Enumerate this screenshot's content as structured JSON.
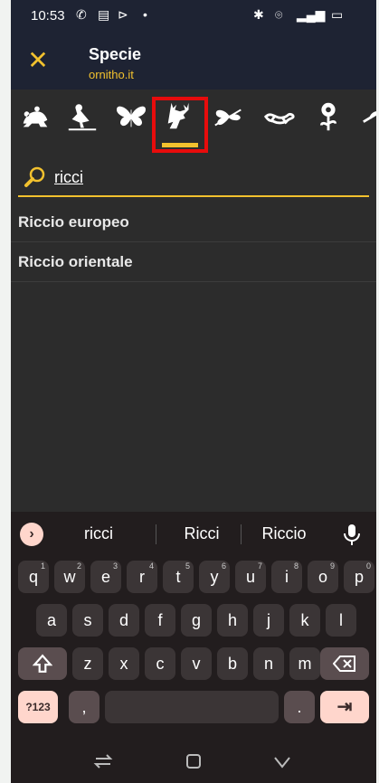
{
  "status": {
    "time": "10:53"
  },
  "appbar": {
    "title": "Specie",
    "subtitle": "ornitho.it"
  },
  "categories": [
    {
      "name": "amphibians",
      "selected": false
    },
    {
      "name": "birds",
      "selected": false
    },
    {
      "name": "butterflies",
      "selected": false
    },
    {
      "name": "mammals",
      "selected": true
    },
    {
      "name": "dragonflies",
      "selected": false
    },
    {
      "name": "reptiles",
      "selected": false
    },
    {
      "name": "plants",
      "selected": false
    },
    {
      "name": "more",
      "selected": false
    }
  ],
  "search": {
    "value": "ricci"
  },
  "results": [
    "Riccio europeo",
    "Riccio orientale"
  ],
  "keyboard": {
    "suggestions": [
      "ricci",
      "Ricci",
      "Riccio"
    ],
    "row1": [
      {
        "k": "q",
        "n": "1"
      },
      {
        "k": "w",
        "n": "2"
      },
      {
        "k": "e",
        "n": "3"
      },
      {
        "k": "r",
        "n": "4"
      },
      {
        "k": "t",
        "n": "5"
      },
      {
        "k": "y",
        "n": "6"
      },
      {
        "k": "u",
        "n": "7"
      },
      {
        "k": "i",
        "n": "8"
      },
      {
        "k": "o",
        "n": "9"
      },
      {
        "k": "p",
        "n": "0"
      }
    ],
    "row2": [
      "a",
      "s",
      "d",
      "f",
      "g",
      "h",
      "j",
      "k",
      "l"
    ],
    "row3": [
      "z",
      "x",
      "c",
      "v",
      "b",
      "n",
      "m"
    ],
    "symbols_label": "?123",
    "comma": ",",
    "period": "."
  },
  "colors": {
    "accent": "#f2c12e",
    "selection_box": "#e80c0c",
    "appbar": "#1e2333"
  }
}
